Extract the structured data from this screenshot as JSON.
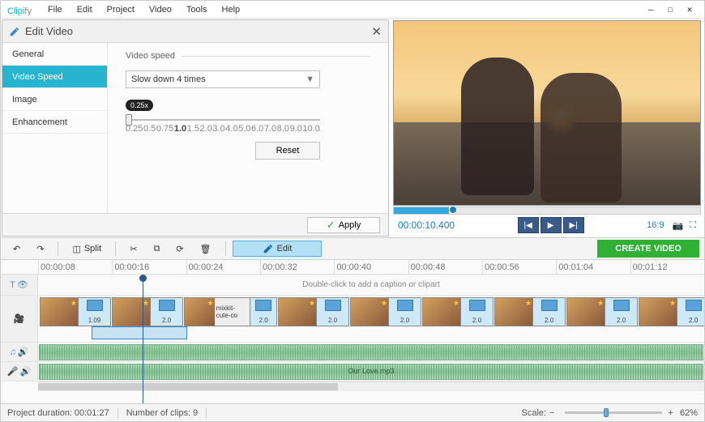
{
  "app": {
    "name_part1": "Clip",
    "name_part2": "ify"
  },
  "menu": {
    "file": "File",
    "edit": "Edit",
    "project": "Project",
    "video": "Video",
    "tools": "Tools",
    "help": "Help"
  },
  "edit_panel": {
    "title": "Edit Video",
    "tabs": {
      "general": "General",
      "video_speed": "Video Speed",
      "image": "Image",
      "enhancement": "Enhancement"
    },
    "section_label": "Video speed",
    "speed_value": "Slow down 4 times",
    "badge": "0.25x",
    "ticks": [
      "0.25",
      "0.5",
      "0.75",
      "1.0",
      "1.5",
      "2.0",
      "3.0",
      "4.0",
      "5.0",
      "6.0",
      "7.0",
      "8.0",
      "9.0",
      "10.0"
    ],
    "reset": "Reset",
    "apply": "Apply"
  },
  "player": {
    "timecode": "00:00:10.400",
    "aspect": "16:9"
  },
  "toolbar": {
    "split": "Split",
    "edit": "Edit",
    "create": "CREATE VIDEO"
  },
  "timeline": {
    "ruler": [
      "00:00:08",
      "00:00:16",
      "00:00:24",
      "00:00:32",
      "00:00:40",
      "00:00:48",
      "00:00:56",
      "00:01:04",
      "00:01:12"
    ],
    "caption_hint": "Double-click to add a caption or clipart",
    "clip_label": "mixkit-cute-co",
    "clip_durations": [
      "1.09",
      "2.0",
      "2.0",
      "2.0",
      "2.0",
      "2.0",
      "2.0",
      "2.0",
      "2.0"
    ],
    "audio_file": "Our Love.mp3"
  },
  "status": {
    "proj_dur_label": "Project duration:",
    "proj_dur": "00:01:27",
    "clips_label": "Number of clips:",
    "clips": "9",
    "scale_label": "Scale:",
    "scale_pct": "62%"
  }
}
